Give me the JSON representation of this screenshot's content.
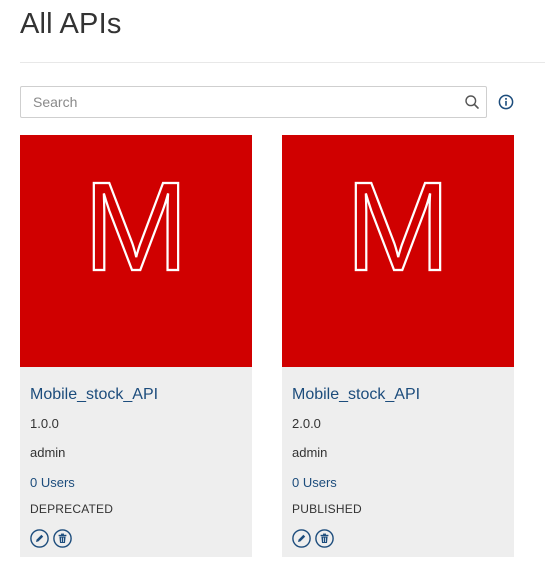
{
  "page": {
    "title": "All APIs"
  },
  "search": {
    "placeholder": "Search",
    "value": ""
  },
  "icons": {
    "search": "search-icon",
    "info": "info-icon",
    "edit": "pencil-icon",
    "delete": "trash-icon"
  },
  "colors": {
    "thumbnail_bg": "#d00000",
    "card_bg": "#eeeeee",
    "link": "#1c4c7c",
    "action_icon": "#1c4c7c"
  },
  "apis": [
    {
      "thumb_letter": "M",
      "name": "Mobile_stock_API",
      "version": "1.0.0",
      "owner": "admin",
      "users": "0 Users",
      "status": "DEPRECATED"
    },
    {
      "thumb_letter": "M",
      "name": "Mobile_stock_API",
      "version": "2.0.0",
      "owner": "admin",
      "users": "0 Users",
      "status": "PUBLISHED"
    }
  ]
}
